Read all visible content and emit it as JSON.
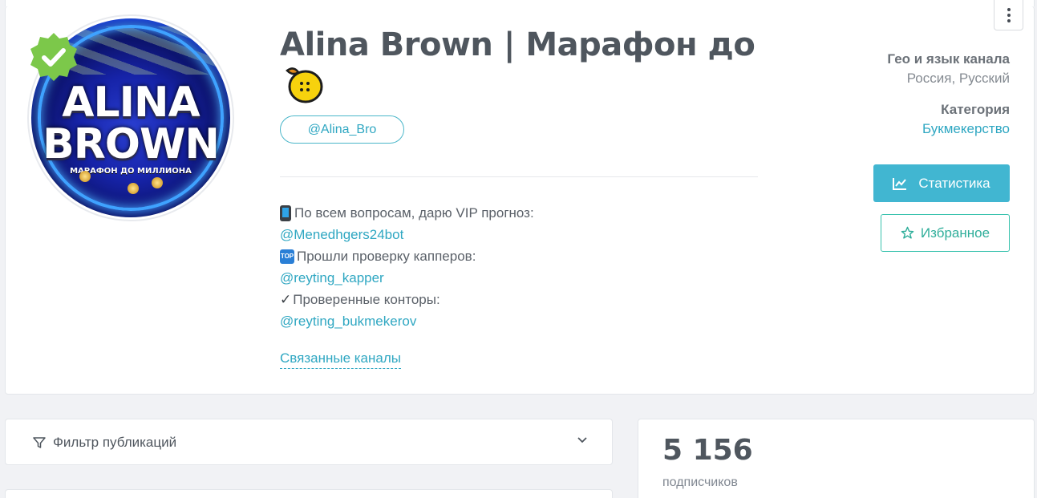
{
  "channel": {
    "title": "Alina Brown | Марафон до",
    "title_emoji": "lemon",
    "handle": "@Alina_Bro",
    "avatar": {
      "text_line1": "ALINA",
      "text_line2": "BROWN",
      "subtitle": "МАРАФОН ДО МИЛЛИОНА"
    },
    "verified_icon": "verified-badge-icon"
  },
  "description": {
    "line1": "По всем вопросам, дарю VIP прогноз:",
    "line2": "@Menedhgers24bot",
    "line3": "Прошли проверку капперов:",
    "line4": "@reyting_kapper",
    "line5": "Проверенные конторы:",
    "line6": "@reyting_bukmekerov",
    "top_emoji_text": "TOP"
  },
  "related_channels": "Связанные каналы",
  "meta": {
    "geo_label": "Гео и язык канала",
    "geo_value": "Россия, Русский",
    "category_label": "Категория",
    "category_value": "Букмекерство"
  },
  "buttons": {
    "stats": "Статистика",
    "favorite": "Избранное"
  },
  "filter": {
    "label": "Фильтр публикаций"
  },
  "subscribers": {
    "count": "5 156",
    "label": "подписчиков"
  },
  "colors": {
    "accent_blue": "#41b6d1",
    "link": "#2fa7c2",
    "favorite_green": "#2fae9a",
    "verified_green": "#7cc84a"
  }
}
